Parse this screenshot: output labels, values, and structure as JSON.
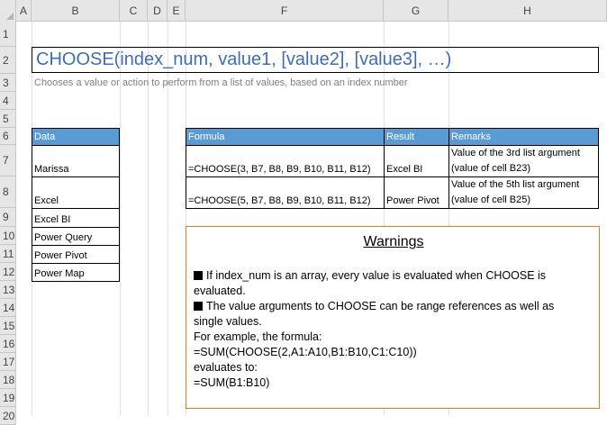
{
  "columns": [
    "A",
    "B",
    "C",
    "D",
    "E",
    "F",
    "G",
    "H"
  ],
  "rows": [
    "1",
    "2",
    "3",
    "4",
    "5",
    "6",
    "7",
    "8",
    "9",
    "10",
    "11",
    "12",
    "13",
    "14",
    "15",
    "16",
    "17",
    "18",
    "19",
    "20"
  ],
  "title": "CHOOSE(index_num, value1, [value2], [value3], …)",
  "subtitle": "Chooses a value or action to perform from a list of values, based on an index number",
  "data_table": {
    "header": "Data",
    "values": [
      "Marissa",
      "Excel",
      "Excel BI",
      "Power Query",
      "Power Pivot",
      "Power Map"
    ]
  },
  "formula_table": {
    "headers": {
      "formula": "Formula",
      "result": "Result",
      "remarks": "Remarks"
    },
    "rows": [
      {
        "formula": "=CHOOSE(3, B7, B8, B9, B10, B11, B12)",
        "result": "Excel BI",
        "remarks_line1": "Value of the 3rd list argument",
        "remarks_line2": "(value of cell B23)"
      },
      {
        "formula": "=CHOOSE(5, B7, B8, B9, B10, B11, B12)",
        "result": "Power Pivot",
        "remarks_line1": "Value of the 5th list argument",
        "remarks_line2": "(value of cell B25)"
      }
    ]
  },
  "warnings": {
    "title": "Warnings",
    "lines": [
      "If index_num is an array, every value is evaluated when CHOOSE is",
      "evaluated.",
      "The value arguments to CHOOSE can be range references as well as",
      "single values.",
      "For example, the formula:",
      "=SUM(CHOOSE(2,A1:A10,B1:B10,C1:C10))",
      "evaluates to:",
      "=SUM(B1:B10)"
    ]
  },
  "colors": {
    "header_fill": "#5b9bd5",
    "title_text": "#3f6db5",
    "warning_border": "#e07b2f"
  }
}
